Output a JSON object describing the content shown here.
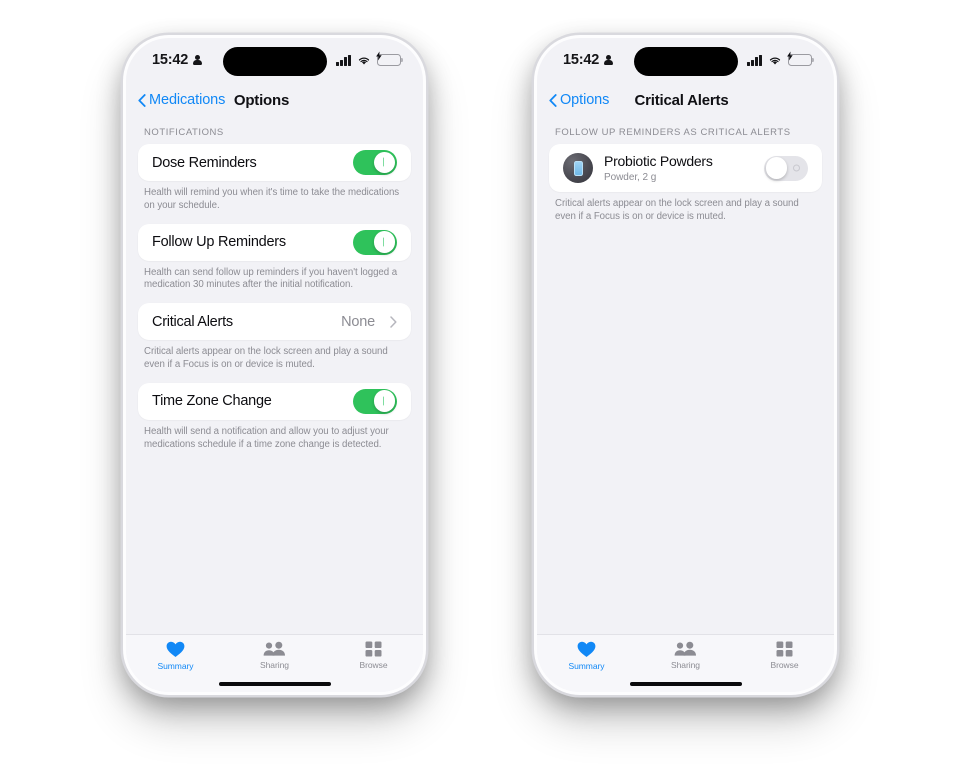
{
  "background_color": "#ffffff",
  "accent_color": "#1188f6",
  "toggle_on_color": "#2fc25b",
  "phones": [
    {
      "status_bar": {
        "time": "15:42",
        "person_icon": "person-icon",
        "cellular_icon": "cellular-signal-icon",
        "wifi_icon": "wifi-icon",
        "battery_icon": "battery-charging-icon"
      },
      "nav": {
        "back_label": "Medications",
        "title": "Options"
      },
      "section_header": "NOTIFICATIONS",
      "rows": [
        {
          "label": "Dose Reminders",
          "control": "toggle",
          "state": "on",
          "footnote": "Health will remind you when it's time to take the medications on your schedule."
        },
        {
          "label": "Follow Up Reminders",
          "control": "toggle",
          "state": "on",
          "footnote": "Health can send follow up reminders if you haven't logged a medication 30 minutes after the initial notification."
        },
        {
          "label": "Critical Alerts",
          "control": "disclosure",
          "value": "None",
          "footnote": "Critical alerts appear on the lock screen and play a sound even if a Focus is on or device is muted."
        },
        {
          "label": "Time Zone Change",
          "control": "toggle",
          "state": "on",
          "footnote": "Health will send a notification and allow you to adjust your medications schedule if a time zone change is detected."
        }
      ],
      "tabs": [
        {
          "label": "Summary",
          "icon": "heart-icon",
          "active": true
        },
        {
          "label": "Sharing",
          "icon": "people-icon",
          "active": false
        },
        {
          "label": "Browse",
          "icon": "grid-icon",
          "active": false
        }
      ]
    },
    {
      "status_bar": {
        "time": "15:42",
        "person_icon": "person-icon",
        "cellular_icon": "cellular-signal-icon",
        "wifi_icon": "wifi-icon",
        "battery_icon": "battery-charging-icon"
      },
      "nav": {
        "back_label": "Options",
        "title": "Critical Alerts"
      },
      "section_header": "FOLLOW UP REMINDERS AS CRITICAL ALERTS",
      "medication": {
        "name": "Probiotic Powders",
        "subtitle": "Powder, 2 g",
        "icon": "powder-packet-icon",
        "state": "off"
      },
      "footnote": "Critical alerts appear on the lock screen and play a sound even if a Focus is on or device is muted.",
      "tabs": [
        {
          "label": "Summary",
          "icon": "heart-icon",
          "active": true
        },
        {
          "label": "Sharing",
          "icon": "people-icon",
          "active": false
        },
        {
          "label": "Browse",
          "icon": "grid-icon",
          "active": false
        }
      ]
    }
  ]
}
